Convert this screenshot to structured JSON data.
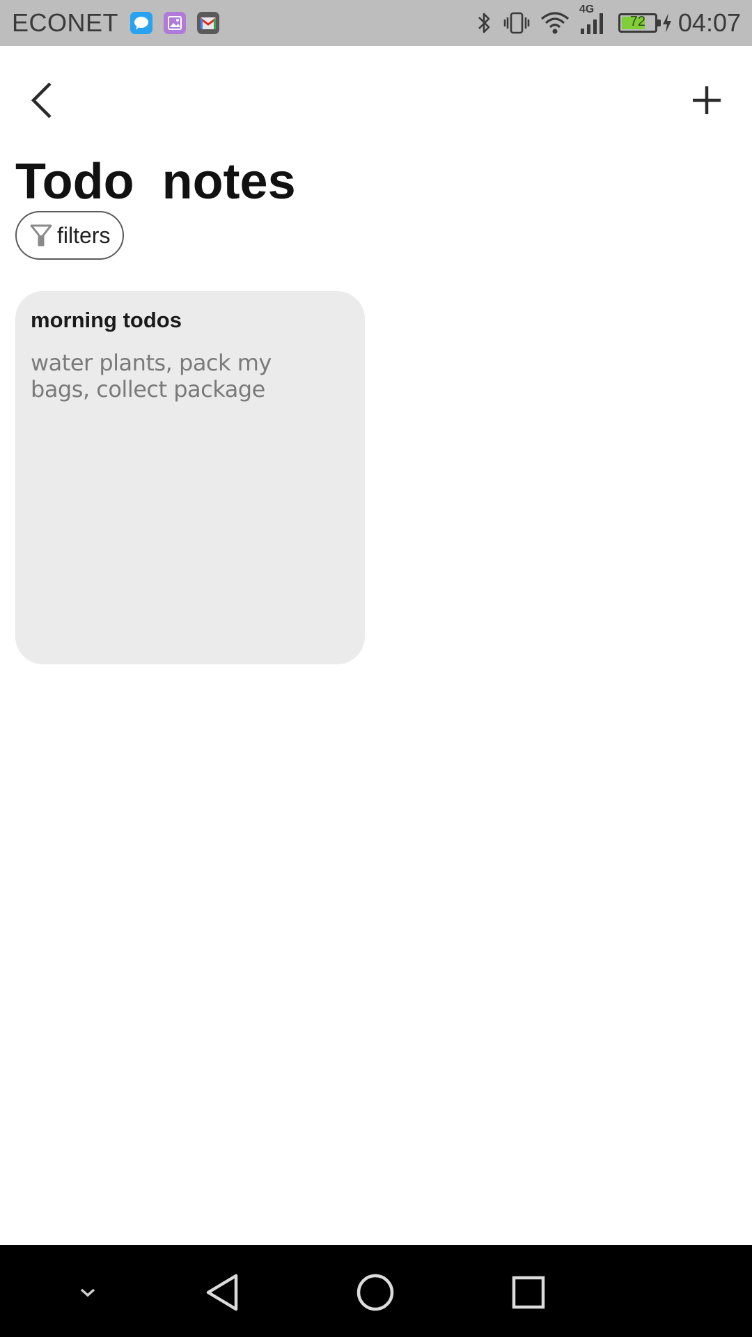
{
  "status_bar": {
    "carrier": "ECONET",
    "battery_level": "72",
    "battery_fraction": 0.72,
    "network_type": "4G",
    "time": "04:07",
    "notification_icons": [
      "messages-icon",
      "gallery-icon",
      "gmail-icon"
    ],
    "system_icons": [
      "bluetooth-icon",
      "vibrate-icon",
      "wifi-icon",
      "cell-signal-icon",
      "battery-icon",
      "charging-icon"
    ]
  },
  "header": {
    "back_icon": "chevron-left-icon",
    "add_icon": "plus-icon",
    "title": "Todo  notes"
  },
  "filters": {
    "icon": "funnel-icon",
    "label": "filters"
  },
  "notes": [
    {
      "title": "morning todos",
      "body": "water plants, pack my bags, collect package"
    }
  ],
  "nav_bar": {
    "items": [
      "chevron-down-icon",
      "back-triangle-icon",
      "home-circle-icon",
      "recents-square-icon"
    ]
  },
  "colors": {
    "status_bar_bg": "#bdbdbd",
    "card_bg": "#ebebeb",
    "nav_bar_bg": "#000000",
    "battery_fill": "#7fce3a",
    "messages_icon": "#29a3f0",
    "gallery_icon": "#b07ad9"
  }
}
